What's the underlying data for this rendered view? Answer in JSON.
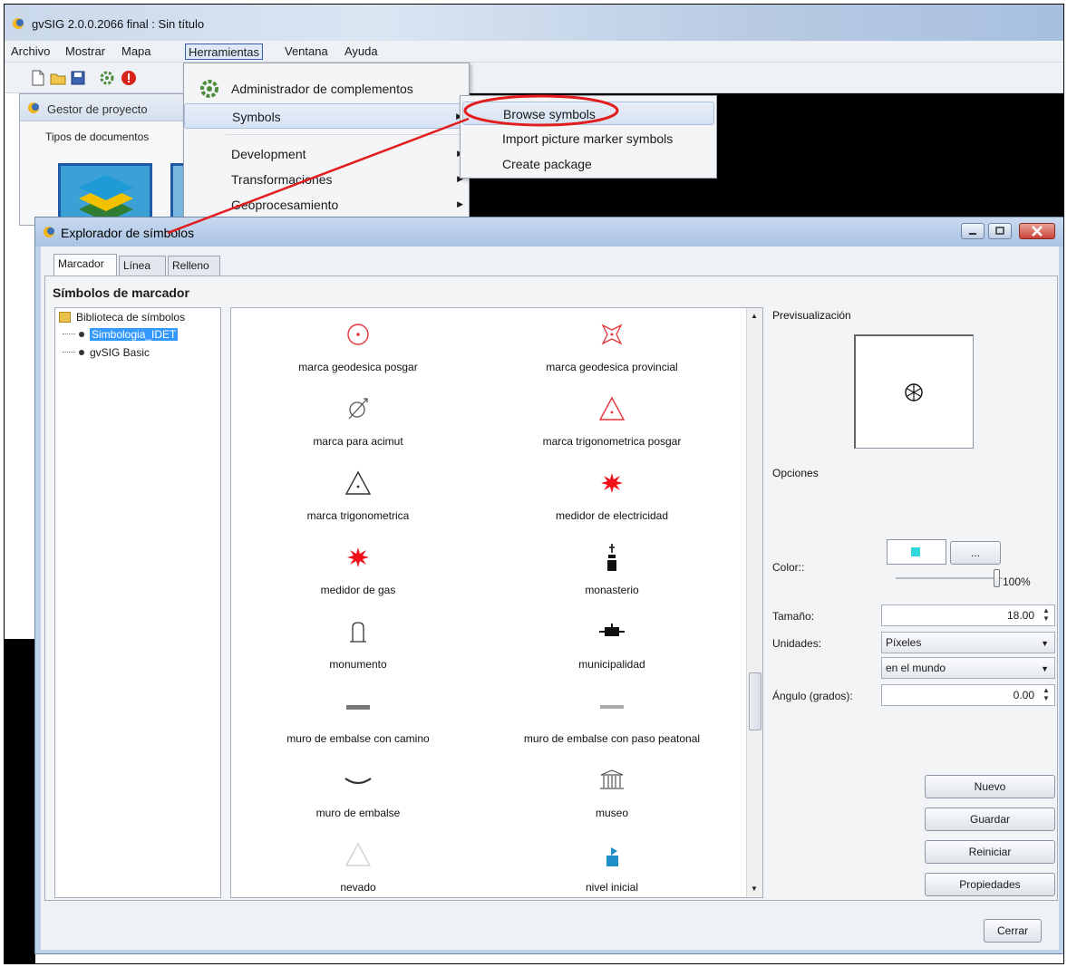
{
  "app": {
    "title": "gvSIG 2.0.0.2066 final : Sin título"
  },
  "menubar": {
    "items": [
      {
        "label": "Archivo"
      },
      {
        "label": "Mostrar"
      },
      {
        "label": "Mapa"
      },
      {
        "label": "Herramientas"
      },
      {
        "label": "Ventana"
      },
      {
        "label": "Ayuda"
      }
    ]
  },
  "project_manager": {
    "title": "Gestor de proyecto",
    "doc_types_label": "Tipos de documentos"
  },
  "tools_menu": {
    "items": [
      {
        "label": "Administrador de complementos"
      },
      {
        "label": "Symbols"
      },
      {
        "label": "Development"
      },
      {
        "label": "Transformaciones"
      },
      {
        "label": "Geoprocesamiento"
      }
    ]
  },
  "symbols_submenu": {
    "items": [
      {
        "label": "Browse symbols"
      },
      {
        "label": "Import picture marker symbols"
      },
      {
        "label": "Create package"
      }
    ]
  },
  "dialog": {
    "title": "Explorador de símbolos",
    "tabs": [
      {
        "label": "Marcador"
      },
      {
        "label": "Línea"
      },
      {
        "label": "Relleno"
      }
    ],
    "section_title": "Símbolos de marcador",
    "tree": {
      "root": "Biblioteca de símbolos",
      "children": [
        {
          "label": "Simbologia_IDET"
        },
        {
          "label": "gvSIG Basic"
        }
      ]
    },
    "symbols": [
      {
        "label": "marca geodesica posgar",
        "icon": "circle-dot-icon"
      },
      {
        "label": "marca geodesica provincial",
        "icon": "star-square-icon"
      },
      {
        "label": "marca para acimut",
        "icon": "azimuth-icon"
      },
      {
        "label": "marca trigonometrica posgar",
        "icon": "red-triangle-icon"
      },
      {
        "label": "marca trigonometrica",
        "icon": "black-triangle-icon"
      },
      {
        "label": "medidor de electricidad",
        "icon": "red-burst-icon"
      },
      {
        "label": "medidor de gas",
        "icon": "red-burst-icon"
      },
      {
        "label": "monasterio",
        "icon": "monastery-icon"
      },
      {
        "label": "monumento",
        "icon": "monument-icon"
      },
      {
        "label": "municipalidad",
        "icon": "municipality-icon"
      },
      {
        "label": "muro de embalse con camino",
        "icon": "dam-road-icon"
      },
      {
        "label": "muro de embalse con paso peatonal",
        "icon": "dam-footpath-icon"
      },
      {
        "label": "muro de embalse",
        "icon": "dam-icon"
      },
      {
        "label": "museo",
        "icon": "museum-icon"
      },
      {
        "label": "nevado",
        "icon": "snow-peak-icon"
      },
      {
        "label": "nivel inicial",
        "icon": "school-flag-icon"
      }
    ],
    "preview_label": "Previsualización",
    "options_label": "Opciones",
    "color_label": "Color::",
    "color_value": "#2fd6dc",
    "color_button": "...",
    "opacity": "100%",
    "size_label": "Tamaño:",
    "size_value": "18.00",
    "units_label": "Unidades:",
    "units_value": "Píxeles",
    "units_ref_value": "en el mundo",
    "angle_label": "Ángulo (grados):",
    "angle_value": "0.00",
    "buttons": {
      "new": "Nuevo",
      "save": "Guardar",
      "reset": "Reiniciar",
      "properties": "Propiedades",
      "close": "Cerrar"
    }
  }
}
